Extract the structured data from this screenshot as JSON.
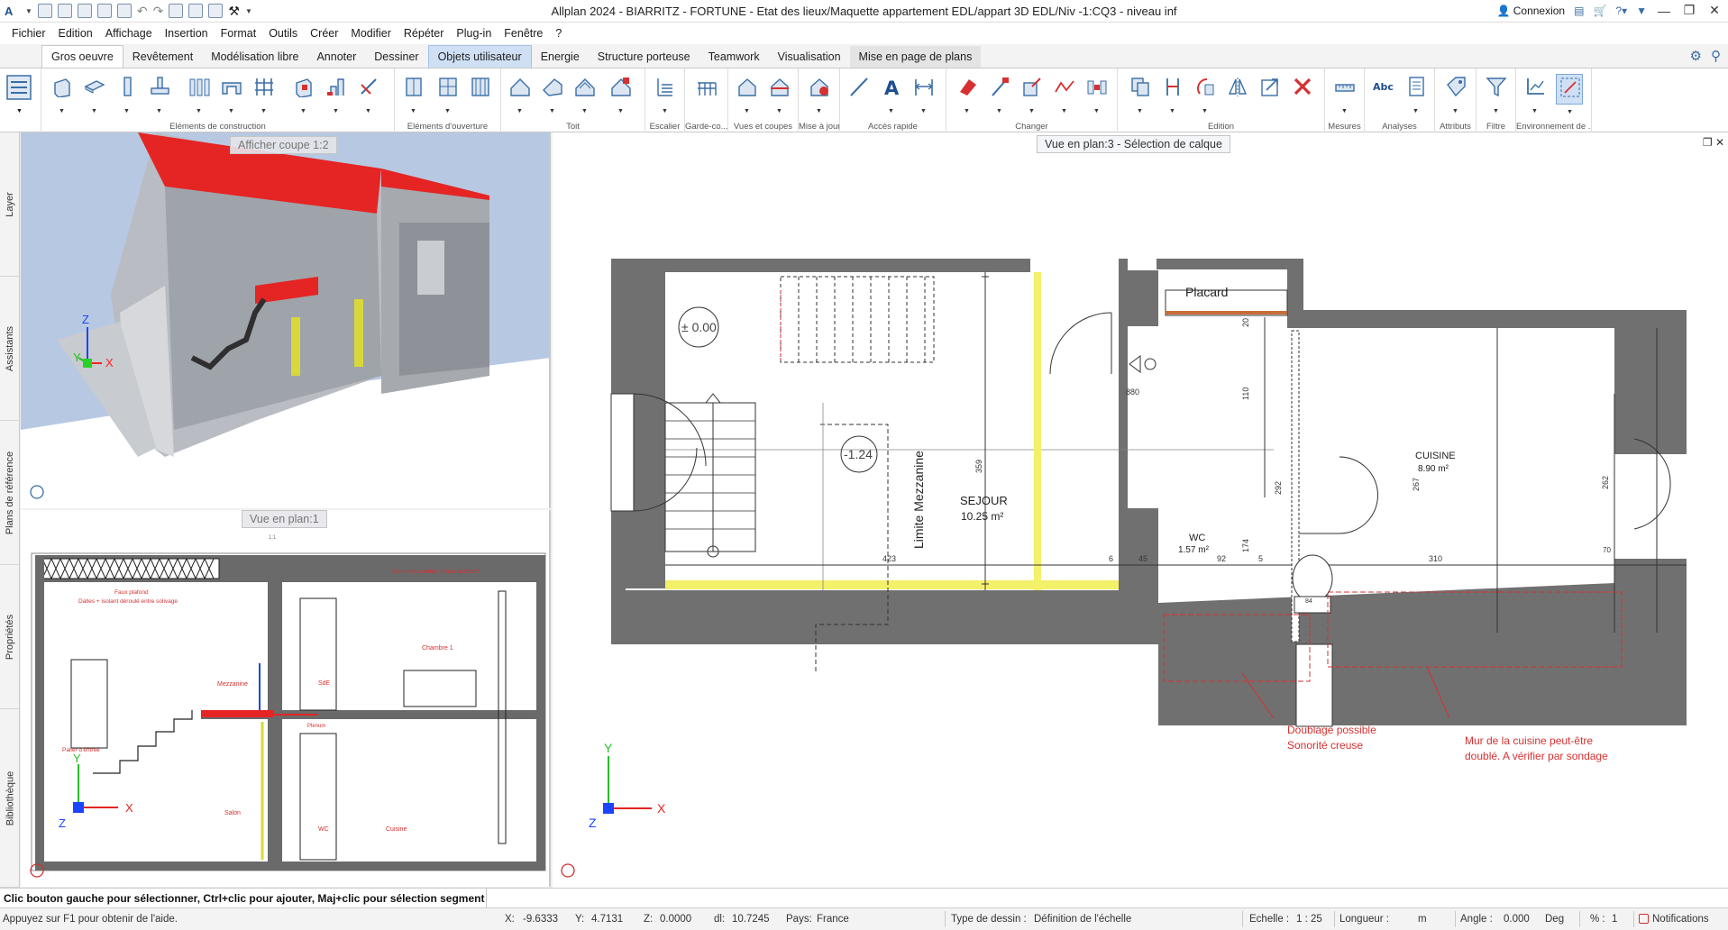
{
  "window": {
    "title": "Allplan 2024 - BIARRITZ - FORTUNE - Etat des lieux/Maquette appartement EDL/appart 3D EDL/Niv -1:CQ3 - niveau inf",
    "connexion_label": "Connexion"
  },
  "menu": [
    "Fichier",
    "Edition",
    "Affichage",
    "Insertion",
    "Format",
    "Outils",
    "Créer",
    "Modifier",
    "Répéter",
    "Plug-in",
    "Fenêtre",
    "?"
  ],
  "tabs": [
    {
      "label": "Gros oeuvre",
      "state": "active"
    },
    {
      "label": "Revêtement",
      "state": ""
    },
    {
      "label": "Modélisation libre",
      "state": ""
    },
    {
      "label": "Annoter",
      "state": ""
    },
    {
      "label": "Dessiner",
      "state": ""
    },
    {
      "label": "Objets utilisateur",
      "state": "highlight"
    },
    {
      "label": "Energie",
      "state": ""
    },
    {
      "label": "Structure porteuse",
      "state": ""
    },
    {
      "label": "Teamwork",
      "state": ""
    },
    {
      "label": "Visualisation",
      "state": ""
    },
    {
      "label": "Mise en page de plans",
      "state": ""
    }
  ],
  "ribbon_groups": [
    {
      "label": "Eléments de construction"
    },
    {
      "label": "Eléments d'ouverture"
    },
    {
      "label": "Toit"
    },
    {
      "label": "Escalier"
    },
    {
      "label": "Garde-co..."
    },
    {
      "label": "Vues et coupes"
    },
    {
      "label": "Mise à jour"
    },
    {
      "label": "Accès rapide"
    },
    {
      "label": "Changer"
    },
    {
      "label": "Edition"
    },
    {
      "label": "Mesures"
    },
    {
      "label": "Analyses"
    },
    {
      "label": "Attributs"
    },
    {
      "label": "Filtre"
    },
    {
      "label": "Environnement de ..."
    }
  ],
  "side_tabs": [
    "Layer",
    "Assistants",
    "Plans de référence",
    "Propriétés",
    "Bibliothèque"
  ],
  "views": {
    "view3d_label": "Afficher coupe 1:2",
    "plan1_label": "Vue en plan:1",
    "plan1_sub": "1:1",
    "plan3_label": "Vue en plan:3 - Sélection de calque"
  },
  "section_texts": {
    "faux_plafond": "Faux plafond",
    "dalles": "Dalles + isolant déroulé entre solivage",
    "zone": "Zone non sondée : Faux plafond?",
    "chambre": "Chambre 1",
    "mezzanine": "Mezzanine",
    "palier": "Palier d'entrée",
    "sde": "SdE",
    "salon": "Salon",
    "wc": "WC",
    "cuisine": "Cuisine",
    "plenum": "Plenum"
  },
  "plan_texts": {
    "level0": "± 0.00",
    "level1": "-1.24",
    "mezzanine": "Limite Mezzanine",
    "sejour": "SEJOUR",
    "sejour_area": "10.25 m²",
    "placard": "Placard",
    "wc": "WC",
    "wc_area": "1.57 m²",
    "cuisine": "CUISINE",
    "cuisine_area": "8.90 m²",
    "dim_423": "423",
    "dim_6": "6",
    "dim_45": "45",
    "dim_92": "92",
    "dim_5": "5",
    "dim_310": "310",
    "dim_359": "359",
    "dim_880": "880",
    "dim_110": "110",
    "dim_292": "292",
    "dim_174": "174",
    "dim_267": "267",
    "dim_262": "262",
    "dim_20": "20",
    "dim_70": "70",
    "dim_84": "84",
    "note1_l1": "Doublage possible",
    "note1_l2": "Sonorité creuse",
    "note2_l1": "Mur de la cuisine peut-être",
    "note2_l2": "doublé. A vérifier par sondage"
  },
  "axes": {
    "x": "X",
    "y": "Y",
    "z": "Z"
  },
  "status": {
    "prompt": "Clic bouton gauche pour sélectionner, Ctrl+clic pour ajouter, Maj+clic pour sélection segment",
    "help": "Appuyez sur F1 pour obtenir de l'aide.",
    "x_label": "X:",
    "x_value": "-9.6333",
    "y_label": "Y:",
    "y_value": "4.7131",
    "z_label": "Z:",
    "z_value": "0.0000",
    "dl_label": "dl:",
    "dl_value": "10.7245",
    "pays_label": "Pays:",
    "pays_value": "France",
    "type_label": "Type de dessin :",
    "type_value": "Définition de l'échelle",
    "echelle_label": "Echelle :",
    "echelle_value": "1 : 25",
    "longueur_label": "Longueur :",
    "longueur_value": "m",
    "angle_label": "Angle :",
    "angle_value": "0.000",
    "angle_unit": "Deg",
    "pct_label": "% :",
    "pct_value": "1",
    "notifications": "Notifications"
  },
  "colors": {
    "accent": "#3a6ea5",
    "wall": "#707070",
    "red_annotation": "#d63030",
    "highlight_yellow": "#f3f06a"
  }
}
